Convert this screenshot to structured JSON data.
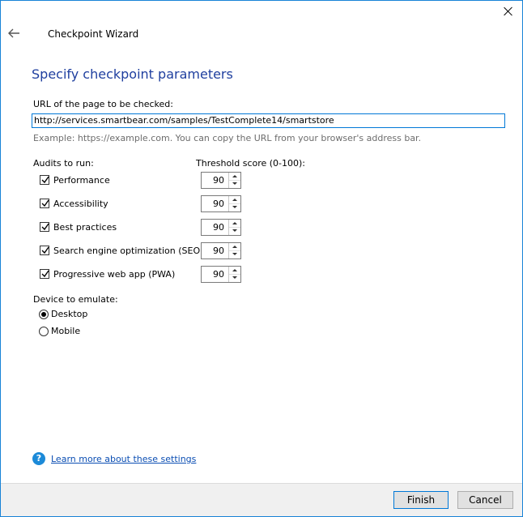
{
  "window": {
    "title": "Checkpoint Wizard"
  },
  "page": {
    "heading": "Specify checkpoint parameters",
    "url_label": "URL of the page to be checked:",
    "url_value": "http://services.smartbear.com/samples/TestComplete14/smartstore",
    "url_hint": "Example: https://example.com. You can copy the URL from your browser's address bar.",
    "audits_label": "Audits to run:",
    "threshold_label": "Threshold score (0-100):",
    "audits": [
      {
        "label": "Performance",
        "checked": true,
        "threshold": "90"
      },
      {
        "label": "Accessibility",
        "checked": true,
        "threshold": "90"
      },
      {
        "label": "Best practices",
        "checked": true,
        "threshold": "90"
      },
      {
        "label": "Search engine optimization (SEO)",
        "checked": true,
        "threshold": "90"
      },
      {
        "label": "Progressive web app (PWA)",
        "checked": true,
        "threshold": "90"
      }
    ],
    "device_label": "Device to emulate:",
    "devices": [
      {
        "label": "Desktop",
        "selected": true
      },
      {
        "label": "Mobile",
        "selected": false
      }
    ],
    "help_link": "Learn more about these settings"
  },
  "footer": {
    "finish_label": "Finish",
    "cancel_label": "Cancel"
  },
  "colors": {
    "accent": "#1883d7",
    "heading": "#1f3f9f",
    "link": "#0b4eb3"
  }
}
